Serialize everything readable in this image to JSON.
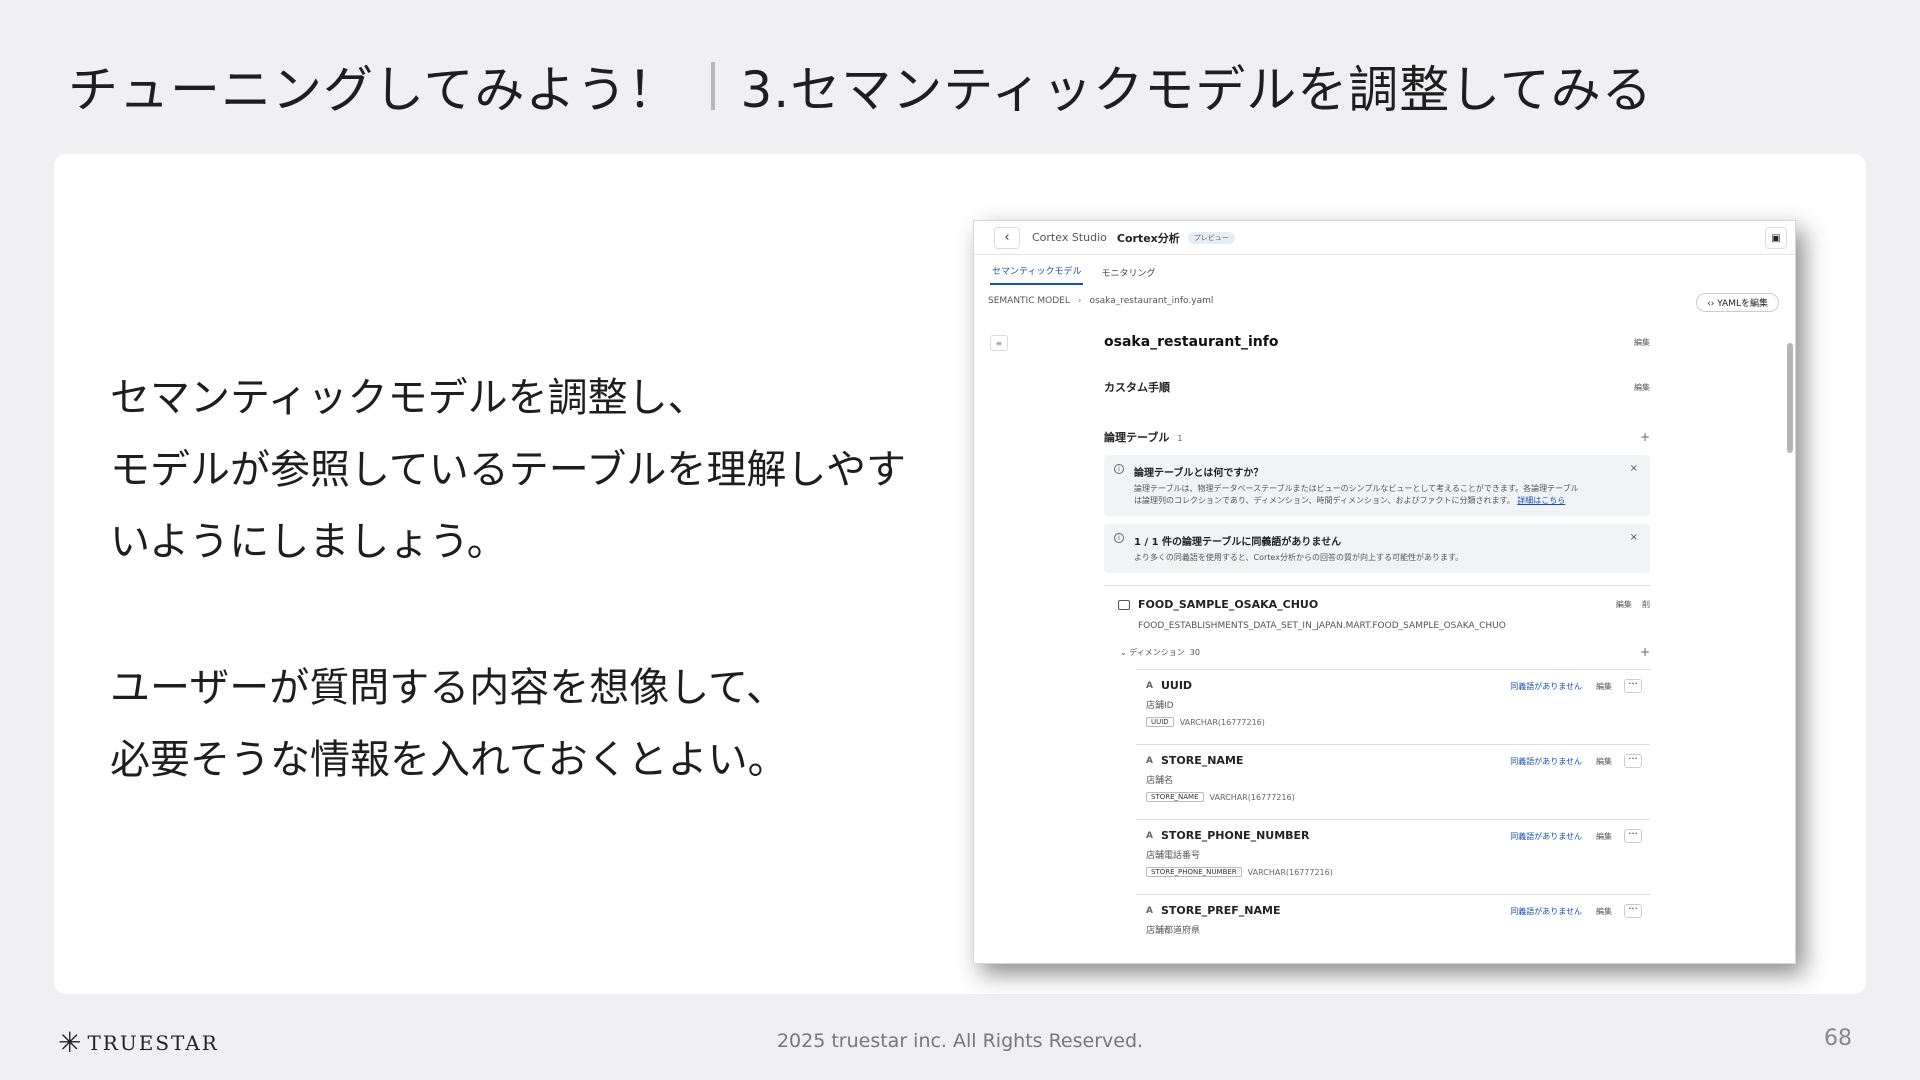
{
  "slide": {
    "title_main": "チューニングしてみよう！",
    "title_sub": "3.セマンティックモデルを調整してみる",
    "body_para1": [
      "セマンティックモデルを調整し、",
      "モデルが参照しているテーブルを理解しやす",
      "いようにしましょう。"
    ],
    "body_para2": [
      "ユーザーが質問する内容を想像して、",
      "必要そうな情報を入れておくとよい。"
    ]
  },
  "screenshot": {
    "crumb_studio": "Cortex Studio",
    "crumb_analyst": "Cortex分析",
    "badge": "プレビュー",
    "tabs": [
      "セマンティックモデル",
      "モニタリング"
    ],
    "path_root": "SEMANTIC MODEL",
    "path_file": "osaka_restaurant_info.yaml",
    "yaml_button": "YAMLを編集",
    "model_name": "osaka_restaurant_info",
    "edit": "編集",
    "custom_steps": "カスタム手順",
    "logical_tables": "論理テーブル",
    "logical_tables_count": "1",
    "info1_title": "論理テーブルとは何ですか？",
    "info1_text1": "論理テーブルは、物理データベーステーブルまたはビューのシンプルなビューとして考えることができます。各論理テーブル",
    "info1_text2": "は論理列のコレクションであり、ディメンション、時間ディメンション、およびファクトに分類されます。",
    "info1_link": "詳細はこちら",
    "info2_title": "1 / 1 件の論理テーブルに同義語がありません",
    "info2_text": "より多くの同義語を使用すると、Cortex分析からの回答の質が向上する可能性があります。",
    "table_name": "FOOD_SAMPLE_OSAKA_CHUO",
    "table_delete": "削",
    "table_path": "FOOD_ESTABLISHMENTS_DATA_SET_IN_JAPAN.MART.FOOD_SAMPLE_OSAKA_CHUO",
    "dimensions_label": "ディメンション",
    "dimensions_count": "30",
    "no_synonyms": "同義語がありません",
    "dims": [
      {
        "name": "UUID",
        "desc": "店舗ID",
        "tag": "UUID",
        "type": "VARCHAR(16777216)"
      },
      {
        "name": "STORE_NAME",
        "desc": "店舗名",
        "tag": "STORE_NAME",
        "type": "VARCHAR(16777216)"
      },
      {
        "name": "STORE_PHONE_NUMBER",
        "desc": "店舗電話番号",
        "tag": "STORE_PHONE_NUMBER",
        "type": "VARCHAR(16777216)"
      },
      {
        "name": "STORE_PREF_NAME",
        "desc": "店舗都道府県",
        "tag": "",
        "type": ""
      }
    ]
  },
  "footer": {
    "logo": "TRUESTAR",
    "copyright": "2025 truestar inc. All Rights Reserved.",
    "page": "68"
  }
}
